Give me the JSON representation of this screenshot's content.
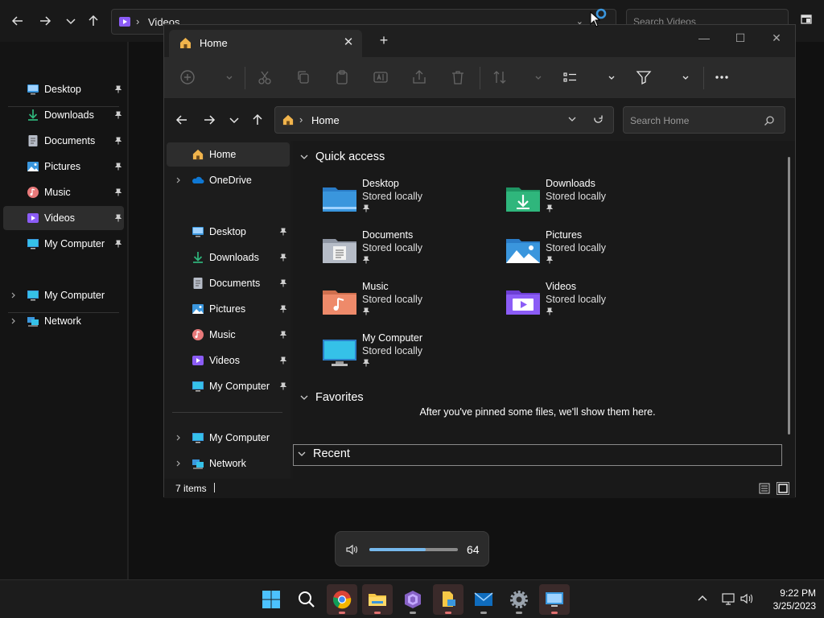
{
  "background_window": {
    "address_text": "Videos",
    "search_placeholder": "Search Videos",
    "sidebar": [
      {
        "label": "Desktop",
        "icon": "desktop-icon",
        "pinned": true
      },
      {
        "label": "Downloads",
        "icon": "downloads-icon",
        "pinned": true
      },
      {
        "label": "Documents",
        "icon": "documents-icon",
        "pinned": true
      },
      {
        "label": "Pictures",
        "icon": "pictures-icon",
        "pinned": true
      },
      {
        "label": "Music",
        "icon": "music-icon",
        "pinned": true
      },
      {
        "label": "Videos",
        "icon": "videos-icon",
        "pinned": true,
        "selected": true
      },
      {
        "label": "My Computer",
        "icon": "computer-icon",
        "pinned": true
      }
    ],
    "sidebar_bottom": [
      {
        "label": "My Computer",
        "icon": "computer-icon"
      },
      {
        "label": "Network",
        "icon": "network-icon"
      }
    ]
  },
  "window": {
    "tab_title": "Home",
    "address_text": "Home",
    "search_placeholder": "Search Home",
    "nav_pane": {
      "top": [
        {
          "label": "Home",
          "icon": "home-icon",
          "selected": true
        },
        {
          "label": "OneDrive",
          "icon": "onedrive-icon"
        }
      ],
      "pinned": [
        {
          "label": "Desktop",
          "icon": "desktop-icon"
        },
        {
          "label": "Downloads",
          "icon": "downloads-icon"
        },
        {
          "label": "Documents",
          "icon": "documents-icon"
        },
        {
          "label": "Pictures",
          "icon": "pictures-icon"
        },
        {
          "label": "Music",
          "icon": "music-icon"
        },
        {
          "label": "Videos",
          "icon": "videos-icon"
        },
        {
          "label": "My Computer",
          "icon": "computer-icon"
        }
      ],
      "bottom": [
        {
          "label": "My Computer",
          "icon": "computer-icon"
        },
        {
          "label": "Network",
          "icon": "network-icon"
        }
      ]
    },
    "quick_access": {
      "title": "Quick access",
      "items": [
        {
          "name": "Desktop",
          "sub": "Stored locally",
          "icon": "desktop-folder-icon"
        },
        {
          "name": "Downloads",
          "sub": "Stored locally",
          "icon": "downloads-folder-icon"
        },
        {
          "name": "Documents",
          "sub": "Stored locally",
          "icon": "documents-folder-icon"
        },
        {
          "name": "Pictures",
          "sub": "Stored locally",
          "icon": "pictures-folder-icon"
        },
        {
          "name": "Music",
          "sub": "Stored locally",
          "icon": "music-folder-icon"
        },
        {
          "name": "Videos",
          "sub": "Stored locally",
          "icon": "videos-folder-icon"
        },
        {
          "name": "My Computer",
          "sub": "Stored locally",
          "icon": "computer-folder-icon"
        }
      ]
    },
    "favorites": {
      "title": "Favorites",
      "empty_message": "After you've pinned some files, we'll show them here."
    },
    "recent": {
      "title": "Recent"
    },
    "status": {
      "item_count": "7 items"
    }
  },
  "volume": {
    "level": 64,
    "level_text": "64"
  },
  "taskbar": {
    "apps": [
      "start-icon",
      "search-icon",
      "chrome-icon",
      "file-explorer-icon",
      "visual-studio-icon",
      "file-transfer-icon",
      "mail-icon",
      "settings-icon",
      "control-panel-icon"
    ],
    "clock_time": "9:22 PM",
    "clock_date": "3/25/2023"
  },
  "colors": {
    "accent": "#76b9ed",
    "folder_blue": "#3a96dd",
    "folder_green": "#2fb67c",
    "folder_purple": "#8b5cf6",
    "folder_gray": "#b6bcc7"
  }
}
